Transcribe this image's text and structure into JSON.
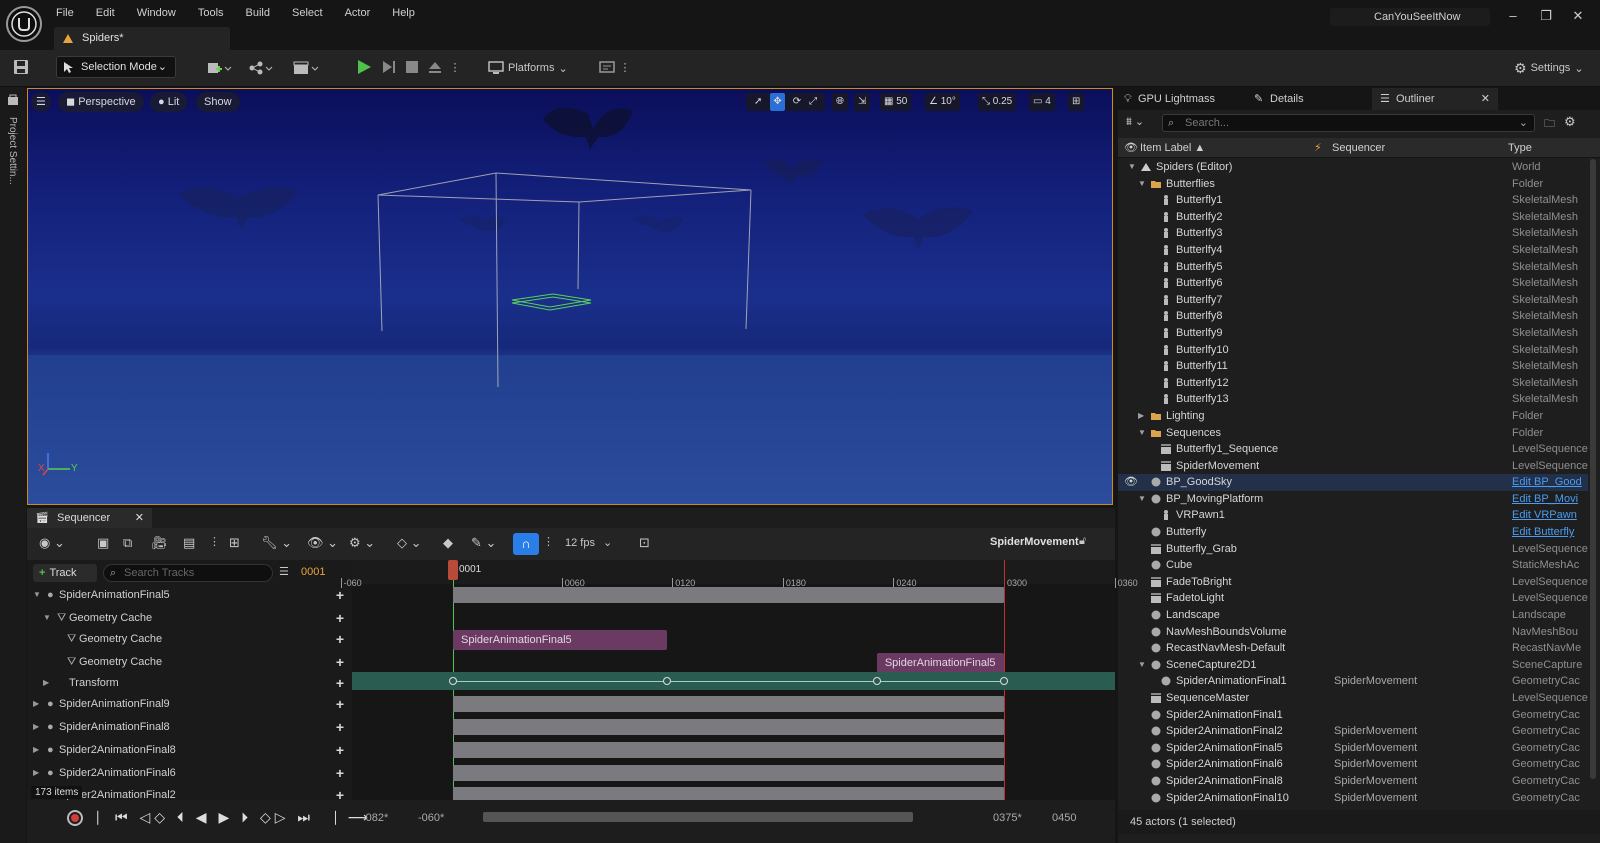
{
  "app": {
    "menu": [
      "File",
      "Edit",
      "Window",
      "Tools",
      "Build",
      "Select",
      "Actor",
      "Help"
    ],
    "doc_tab": "Spiders*",
    "user": "CanYouSeeItNow"
  },
  "toolbar": {
    "selection_mode": "Selection Mode",
    "platforms": "Platforms",
    "settings": "Settings"
  },
  "left_strip": {
    "label": "Project Settin..."
  },
  "viewport": {
    "perspective": "Perspective",
    "lit": "Lit",
    "show": "Show",
    "grid_snap": "50",
    "rot_snap": "10°",
    "scale_snap": "0.25",
    "camera_speed": "4",
    "axis_y": "Y",
    "axis_x": "X"
  },
  "right_panel": {
    "tabs": [
      "GPU Lightmass",
      "Details",
      "Outliner"
    ],
    "search_placeholder": "Search...",
    "col_label": "Item Label ▲",
    "col_seq": "Sequencer",
    "col_type": "Type",
    "status": "45 actors (1 selected)",
    "rows": [
      {
        "label": "Spiders (Editor)",
        "type": "World",
        "level": 0,
        "expanded": true,
        "seq": ""
      },
      {
        "label": "Butterflies",
        "type": "Folder",
        "level": 1,
        "expanded": true,
        "seq": ""
      },
      {
        "label": "Butterfly1",
        "type": "SkeletalMesh",
        "level": 2,
        "seq": ""
      },
      {
        "label": "Butterlfy2",
        "type": "SkeletalMesh",
        "level": 2,
        "seq": ""
      },
      {
        "label": "Butterlfy3",
        "type": "SkeletalMesh",
        "level": 2,
        "seq": ""
      },
      {
        "label": "Butterlfy4",
        "type": "SkeletalMesh",
        "level": 2,
        "seq": ""
      },
      {
        "label": "Butterlfy5",
        "type": "SkeletalMesh",
        "level": 2,
        "seq": ""
      },
      {
        "label": "Butterlfy6",
        "type": "SkeletalMesh",
        "level": 2,
        "seq": ""
      },
      {
        "label": "Butterlfy7",
        "type": "SkeletalMesh",
        "level": 2,
        "seq": ""
      },
      {
        "label": "Butterlfy8",
        "type": "SkeletalMesh",
        "level": 2,
        "seq": ""
      },
      {
        "label": "Butterlfy9",
        "type": "SkeletalMesh",
        "level": 2,
        "seq": ""
      },
      {
        "label": "Butterlfy10",
        "type": "SkeletalMesh",
        "level": 2,
        "seq": ""
      },
      {
        "label": "Butterlfy11",
        "type": "SkeletalMesh",
        "level": 2,
        "seq": ""
      },
      {
        "label": "Butterlfy12",
        "type": "SkeletalMesh",
        "level": 2,
        "seq": ""
      },
      {
        "label": "Butterlfy13",
        "type": "SkeletalMesh",
        "level": 2,
        "seq": ""
      },
      {
        "label": "Lighting",
        "type": "Folder",
        "level": 1,
        "expanded": false,
        "seq": ""
      },
      {
        "label": "Sequences",
        "type": "Folder",
        "level": 1,
        "expanded": true,
        "seq": ""
      },
      {
        "label": "Butterfly1_Sequence",
        "type": "LevelSequence",
        "level": 2,
        "seq": ""
      },
      {
        "label": "SpiderMovement",
        "type": "LevelSequence",
        "level": 2,
        "seq": ""
      },
      {
        "label": "BP_GoodSky",
        "type": "Edit BP_Good",
        "level": 1,
        "link": true,
        "selected": true,
        "seq": ""
      },
      {
        "label": "BP_MovingPlatform",
        "type": "Edit BP_Movi",
        "level": 1,
        "expanded": true,
        "link": true,
        "seq": ""
      },
      {
        "label": "VRPawn1",
        "type": "Edit VRPawn",
        "level": 2,
        "link": true,
        "seq": ""
      },
      {
        "label": "Butterfly",
        "type": "Edit Butterfly",
        "level": 1,
        "link": true,
        "seq": ""
      },
      {
        "label": "Butterfly_Grab",
        "type": "LevelSequence",
        "level": 1,
        "seq": ""
      },
      {
        "label": "Cube",
        "type": "StaticMeshAc",
        "level": 1,
        "seq": ""
      },
      {
        "label": "FadeToBright",
        "type": "LevelSequence",
        "level": 1,
        "seq": ""
      },
      {
        "label": "FadetoLight",
        "type": "LevelSequence",
        "level": 1,
        "seq": ""
      },
      {
        "label": "Landscape",
        "type": "Landscape",
        "level": 1,
        "seq": ""
      },
      {
        "label": "NavMeshBoundsVolume",
        "type": "NavMeshBou",
        "level": 1,
        "seq": ""
      },
      {
        "label": "RecastNavMesh-Default",
        "type": "RecastNavMe",
        "level": 1,
        "seq": ""
      },
      {
        "label": "SceneCapture2D1",
        "type": "SceneCapture",
        "level": 1,
        "expanded": true,
        "seq": ""
      },
      {
        "label": "SpiderAnimationFinal1",
        "type": "GeometryCac",
        "level": 2,
        "seq": "SpiderMovement"
      },
      {
        "label": "SequenceMaster",
        "type": "LevelSequence",
        "level": 1,
        "seq": ""
      },
      {
        "label": "Spider2AnimationFinal1",
        "type": "GeometryCac",
        "level": 1,
        "seq": ""
      },
      {
        "label": "Spider2AnimationFinal2",
        "type": "GeometryCac",
        "level": 1,
        "seq": "SpiderMovement"
      },
      {
        "label": "Spider2AnimationFinal5",
        "type": "GeometryCac",
        "level": 1,
        "seq": "SpiderMovement"
      },
      {
        "label": "Spider2AnimationFinal6",
        "type": "GeometryCac",
        "level": 1,
        "seq": "SpiderMovement"
      },
      {
        "label": "Spider2AnimationFinal8",
        "type": "GeometryCac",
        "level": 1,
        "seq": "SpiderMovement"
      },
      {
        "label": "Spider2AnimationFinal10",
        "type": "GeometryCac",
        "level": 1,
        "seq": "SpiderMovement"
      }
    ]
  },
  "sequencer": {
    "tab": "Sequencer",
    "fps": "12 fps",
    "sequence_name": "SpiderMovement",
    "add_track": "Track",
    "search_placeholder": "Search Tracks",
    "current_frame": "0001",
    "ruler": [
      "-060",
      "0001",
      "0060",
      "0120",
      "0180",
      "0240",
      "0300",
      "0360"
    ],
    "tracks": [
      {
        "label": "SpiderAnimationFinal5",
        "indent": 0,
        "expanded": true
      },
      {
        "label": "Geometry Cache",
        "indent": 1,
        "expanded": true
      },
      {
        "label": "Geometry Cache",
        "indent": 2
      },
      {
        "label": "Geometry Cache",
        "indent": 2
      },
      {
        "label": "Transform",
        "indent": 1,
        "expanded": false
      },
      {
        "label": "SpiderAnimationFinal9",
        "indent": 0
      },
      {
        "label": "SpiderAnimationFinal8",
        "indent": 0
      },
      {
        "label": "Spider2AnimationFinal8",
        "indent": 0
      },
      {
        "label": "Spider2AnimationFinal6",
        "indent": 0
      },
      {
        "label": "Spider2AnimationFinal2",
        "indent": 0
      }
    ],
    "sections": [
      "SpiderAnimationFinal5",
      "SpiderAnimationFinal5"
    ],
    "items_count": "173 items",
    "view_start": "-082*",
    "view_start2": "-060*",
    "view_end": "0375*",
    "view_end2": "0450"
  }
}
